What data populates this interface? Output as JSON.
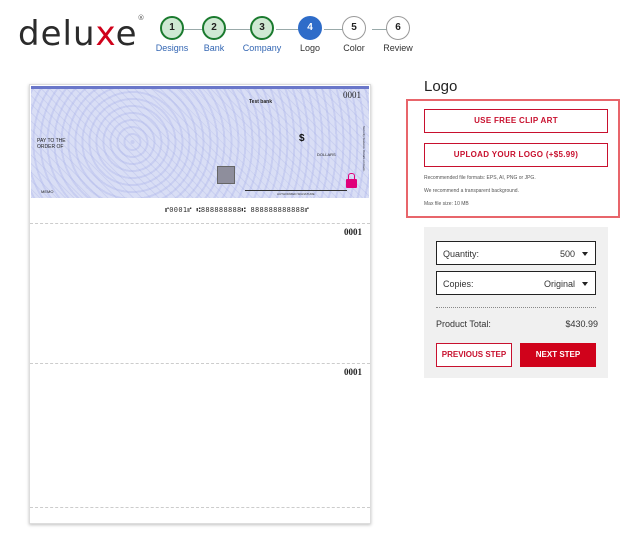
{
  "brand": {
    "logo_prefix": "delu",
    "logo_accent": "x",
    "logo_suffix": "e",
    "logo_mark": "®"
  },
  "stepper": {
    "steps": [
      {
        "number": "1",
        "label": "Designs",
        "state": "done"
      },
      {
        "number": "2",
        "label": "Bank",
        "state": "done"
      },
      {
        "number": "3",
        "label": "Company",
        "state": "done"
      },
      {
        "number": "4",
        "label": "Logo",
        "state": "active"
      },
      {
        "number": "5",
        "label": "Color",
        "state": "todo"
      },
      {
        "number": "6",
        "label": "Review",
        "state": "todo"
      }
    ]
  },
  "check": {
    "number": "0001",
    "bank_name": "Test bank",
    "pay_to_line1": "PAY TO THE",
    "pay_to_line2": "ORDER OF",
    "dollar_sign": "$",
    "dollars_label": "DOLLARS",
    "memo_label": "MEMO",
    "signature_label": "AUTHORIZED SIGNATURE",
    "side_text": "Security features. Details on back.",
    "micr_line": "⑈0001⑈ ⑆888888888⑆ 888888888888⑈",
    "stub1_number": "0001",
    "stub2_number": "0001"
  },
  "logo_section": {
    "title": "Logo",
    "clip_art_button": "USE FREE CLIP ART",
    "upload_button": "UPLOAD YOUR LOGO (+$5.99)",
    "note_formats": "Recommended file formats: EPS, AI, PNG or JPG.",
    "note_background": "We recommend a transparent background.",
    "note_size": "Max file size: 10 MB"
  },
  "order": {
    "quantity_label": "Quantity:",
    "quantity_value": "500",
    "copies_label": "Copies:",
    "copies_value": "Original",
    "total_label": "Product Total:",
    "total_value": "$430.99",
    "prev_button": "PREVIOUS STEP",
    "next_button": "NEXT STEP"
  },
  "colors": {
    "brand_red": "#d0021b",
    "active_step_blue": "#2e6cc9",
    "done_step_green": "#1a7a2e",
    "highlight_box": "#e8656b"
  }
}
